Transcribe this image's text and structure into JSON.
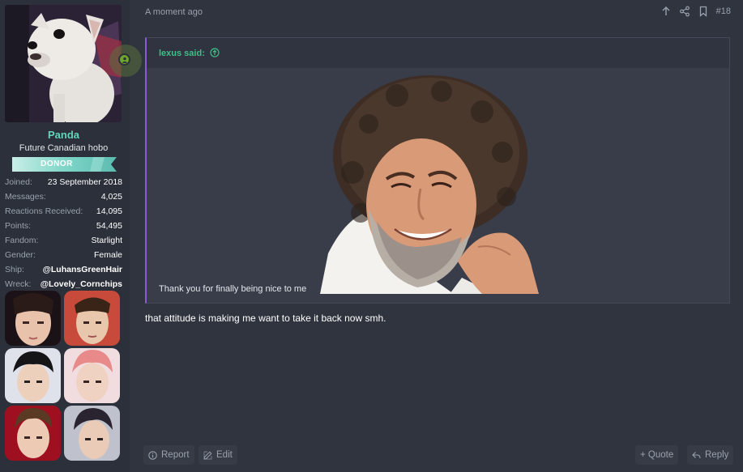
{
  "user": {
    "username": "Panda",
    "title": "Future Canadian hobo",
    "banner": "DONOR",
    "stats": [
      {
        "key": "Joined:",
        "value": "23 September 2018"
      },
      {
        "key": "Messages:",
        "value": "4,025"
      },
      {
        "key": "Reactions Received:",
        "value": "14,095"
      },
      {
        "key": "Points:",
        "value": "54,495"
      },
      {
        "key": "Fandom:",
        "value": "Starlight"
      },
      {
        "key": "Gender:",
        "value": "Female"
      },
      {
        "key": "Ship:",
        "value": "@LuhansGreenHair"
      },
      {
        "key": "Wreck:",
        "value": "@Lovely_Cornchips"
      }
    ],
    "colors": {
      "username": "#62d6b9",
      "banner": "#7fd6c8",
      "online": "#6ea62a"
    }
  },
  "post": {
    "time": "A moment ago",
    "number": "#18",
    "quote": {
      "author": "lexus said:",
      "text": "Thank you for finally being nice to me",
      "accent": "#8a5bd0",
      "author_color": "#3fbf86"
    },
    "body": "that attitude is making me want to take it back now smh."
  },
  "footer": {
    "report": "Report",
    "edit": "Edit",
    "quote": "+ Quote",
    "reply": "Reply"
  },
  "icons": [
    "up-arrow-icon",
    "share-icon",
    "bookmark-icon",
    "user-status-icon",
    "info-icon",
    "edit-icon",
    "reply-icon"
  ]
}
